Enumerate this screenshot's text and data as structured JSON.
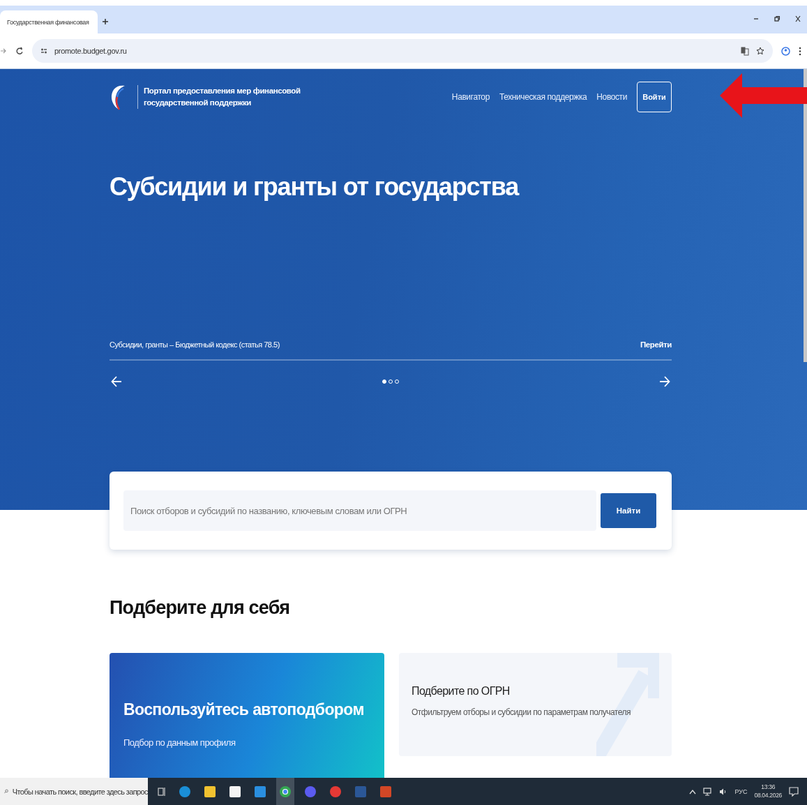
{
  "browser": {
    "tab_title": "Государственная финансовая",
    "address": "promote.budget.gov.ru"
  },
  "header": {
    "logo_text": "Портал предоставления мер финансовой государственной поддержки",
    "nav": [
      "Навигатор",
      "Техническая поддержка",
      "Новости"
    ],
    "login": "Войти"
  },
  "hero": {
    "title": "Субсидии и гранты от государства",
    "caption": "Субсидии, гранты – Бюджетный кодекс (статья 78.5)",
    "go_link": "Перейти",
    "dots": [
      {
        "selected": true
      },
      {
        "selected": false
      },
      {
        "selected": false
      }
    ]
  },
  "search": {
    "placeholder": "Поиск отборов и субсидий по названию, ключевым словам или ОГРН",
    "button": "Найти"
  },
  "section": {
    "title": "Подберите для себя",
    "cards": [
      {
        "kind": "accent",
        "title": "Воспользуйтесь автоподбором",
        "subtitle": "Подбор по данным профиля"
      },
      {
        "kind": "plain",
        "title": "Подберите по ОГРН",
        "subtitle": "Отфильтруем отборы и субсидии по параметрам получателя"
      }
    ]
  },
  "taskbar": {
    "search_placeholder": "Чтобы начать поиск, введите здесь запрос",
    "apps": [
      {
        "selected": false
      },
      {
        "selected": false
      },
      {
        "selected": false
      },
      {
        "selected": false
      },
      {
        "selected": true
      },
      {
        "selected": false
      },
      {
        "selected": false
      },
      {
        "selected": false
      },
      {
        "selected": false
      }
    ],
    "language": "РУС",
    "time": "13:36",
    "date": "08.04.2026"
  }
}
